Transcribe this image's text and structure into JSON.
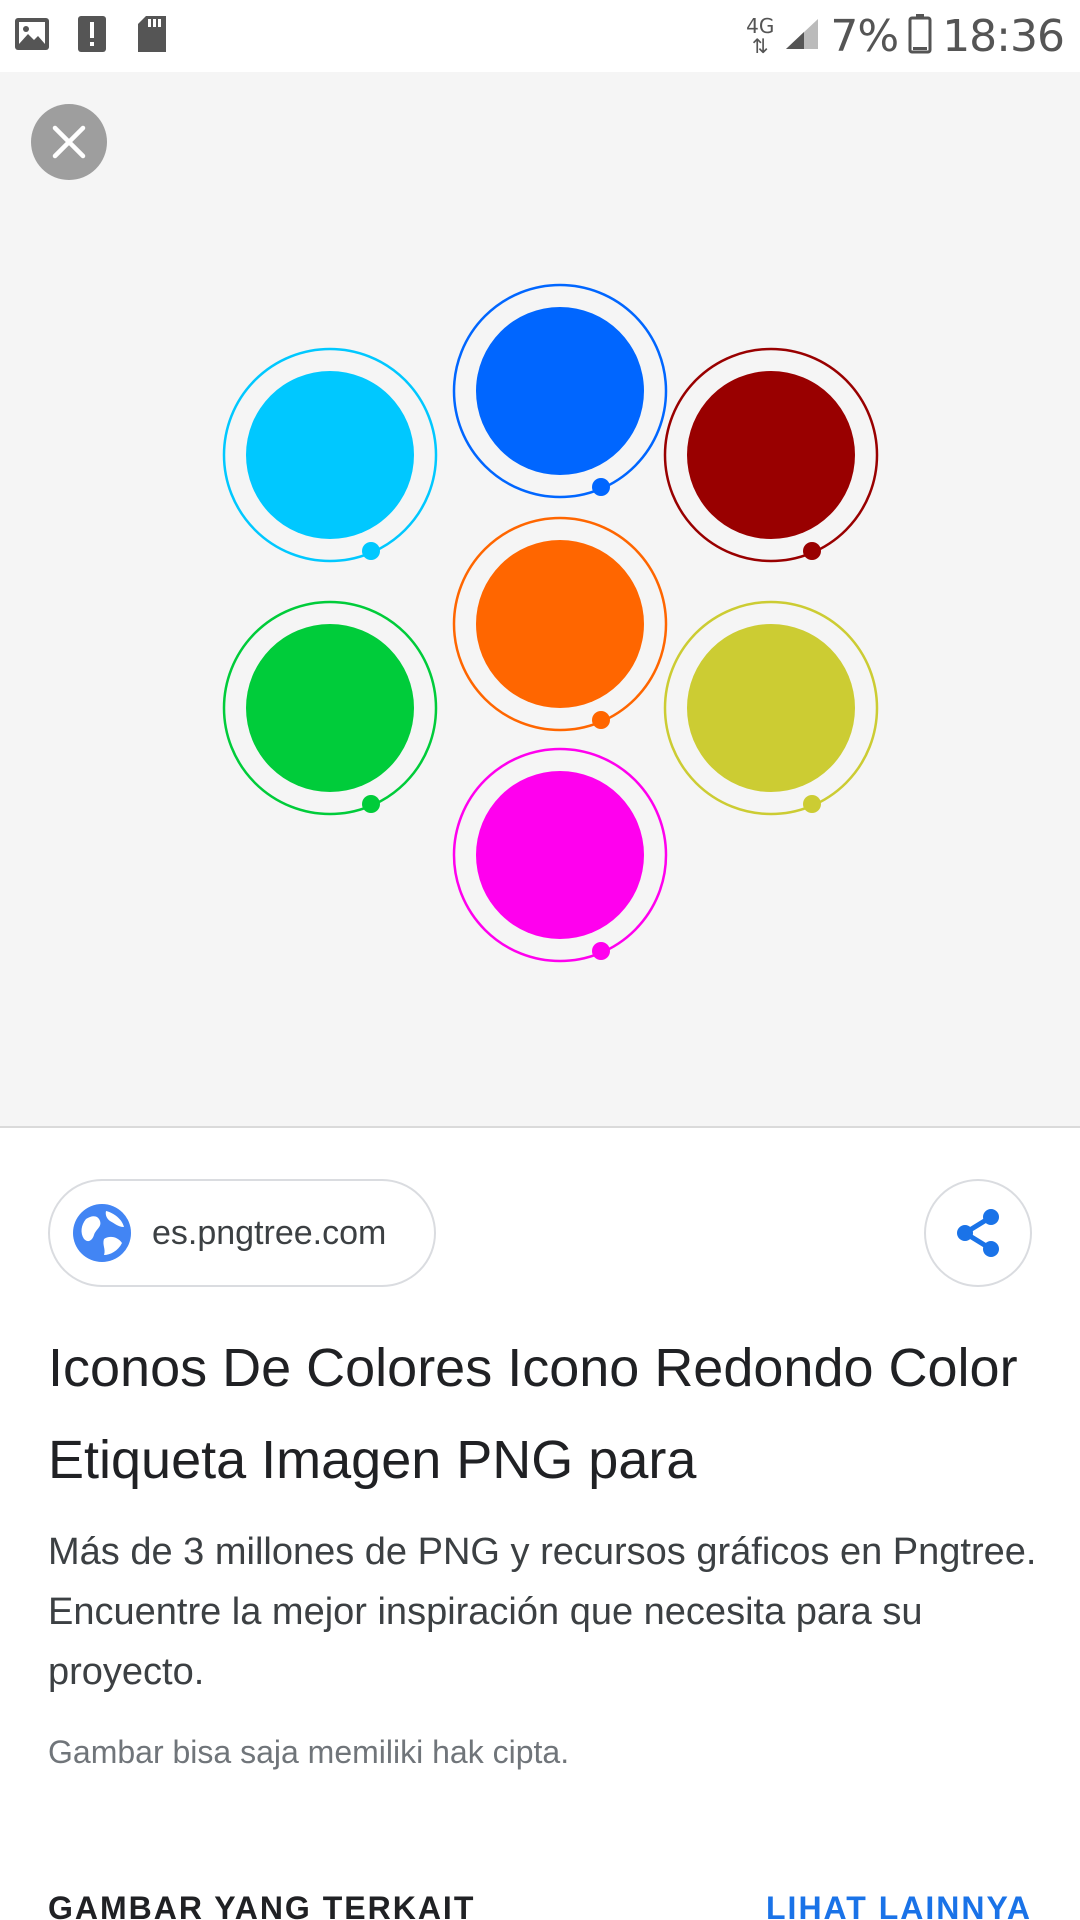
{
  "status_bar": {
    "network": "4G",
    "battery_percent": "7%",
    "time": "18:36",
    "left_icons": [
      "image-notification-icon",
      "alert-notification-icon",
      "sd-card-icon"
    ]
  },
  "viewer": {
    "close_icon": "close-icon",
    "circle_colors": {
      "cyan": "#00c8ff",
      "blue": "#0066ff",
      "dark_red": "#990000",
      "orange": "#ff6600",
      "green": "#00cc3a",
      "yellow": "#cccc33",
      "magenta": "#ff00ee"
    }
  },
  "info": {
    "source": "es.pngtree.com",
    "title": "Iconos De Colores Icono Redondo Color Etiqueta Imagen PNG para",
    "description": "Más de 3 millones de PNG y recursos gráficos en Pngtree. Encuentre la mejor inspiración que necesita para su proyecto.",
    "copyright_note": "Gambar bisa saja memiliki hak cipta."
  },
  "related": {
    "heading": "GAMBAR YANG TERKAIT",
    "see_more": "LIHAT LAINNYA"
  },
  "colors": {
    "accent": "#1a73e8",
    "viewer_bg": "#f5f5f5"
  }
}
